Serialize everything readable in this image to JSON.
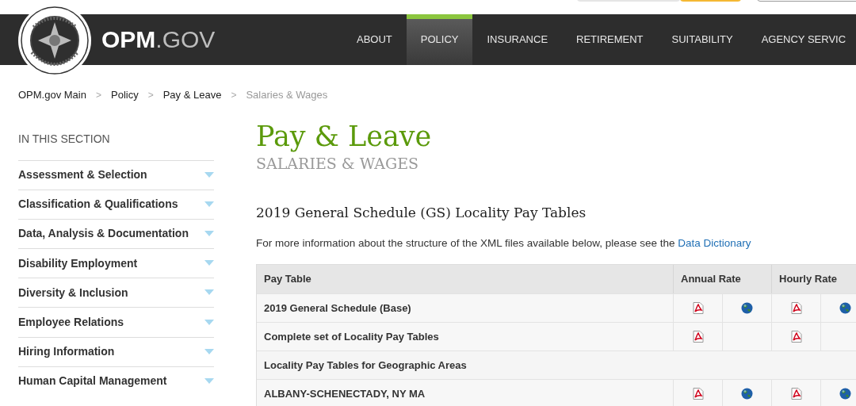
{
  "site": {
    "brand_bold": "OPM",
    "brand_light": ".GOV"
  },
  "nav": [
    {
      "label": "ABOUT",
      "selected": false
    },
    {
      "label": "POLICY",
      "selected": true
    },
    {
      "label": "INSURANCE",
      "selected": false
    },
    {
      "label": "RETIREMENT",
      "selected": false
    },
    {
      "label": "SUITABILITY",
      "selected": false
    },
    {
      "label": "AGENCY SERVIC",
      "selected": false
    }
  ],
  "breadcrumbs": [
    {
      "label": "OPM.gov Main",
      "current": false
    },
    {
      "label": "Policy",
      "current": false
    },
    {
      "label": "Pay & Leave",
      "current": false
    },
    {
      "label": "Salaries & Wages",
      "current": true
    }
  ],
  "breadcrumb_separator": ">",
  "sidebar": {
    "heading": "IN THIS SECTION",
    "items": [
      {
        "label": "Assessment & Selection"
      },
      {
        "label": "Classification & Qualifications"
      },
      {
        "label": "Data, Analysis & Documentation"
      },
      {
        "label": "Disability Employment"
      },
      {
        "label": "Diversity & Inclusion"
      },
      {
        "label": "Employee Relations"
      },
      {
        "label": "Hiring Information"
      },
      {
        "label": "Human Capital Management"
      }
    ]
  },
  "page": {
    "title": "Pay & Leave",
    "subtitle": "SALARIES & WAGES",
    "section_title": "2019 General Schedule (GS) Locality Pay Tables",
    "intro": "For more information about the structure of the XML files available below, please see the",
    "intro_link": "Data Dictionary"
  },
  "table": {
    "columns": [
      "Pay Table",
      "Annual Rate",
      "Hourly Rate"
    ],
    "rows": [
      {
        "kind": "file",
        "label": "2019 General Schedule (Base)",
        "annual_pdf": true,
        "annual_web": true,
        "hourly_pdf": true,
        "hourly_web": true
      },
      {
        "kind": "file",
        "label": "Complete set of Locality Pay Tables",
        "annual_pdf": true,
        "annual_web": false,
        "hourly_pdf": true,
        "hourly_web": false
      },
      {
        "kind": "group",
        "label": "Locality Pay Tables for Geographic Areas"
      },
      {
        "kind": "file",
        "label": "ALBANY-SCHENECTADY, NY MA",
        "annual_pdf": true,
        "annual_web": true,
        "hourly_pdf": true,
        "hourly_web": true
      }
    ]
  }
}
